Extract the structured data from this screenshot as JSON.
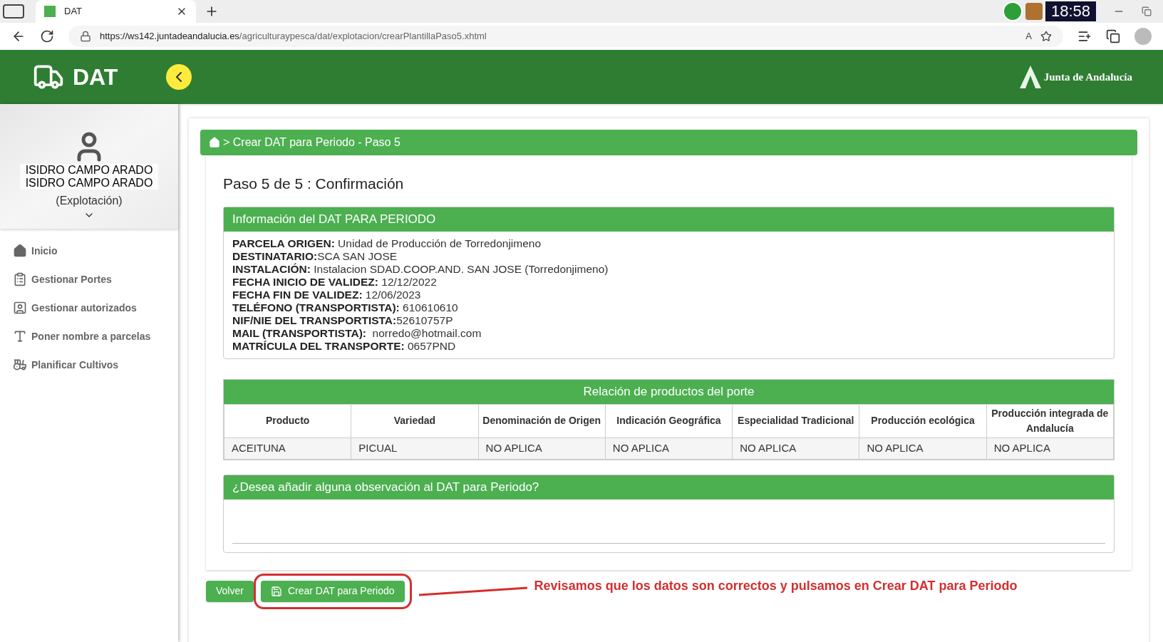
{
  "browser": {
    "tab_title": "DAT",
    "clock": "18:58",
    "url_host": "https://ws142.juntadeandalucia.es",
    "url_path": "/agriculturaypesca/dat/explotacion/crearPlantillaPaso5.xhtml",
    "reader_label": "A"
  },
  "header": {
    "app_name": "DAT",
    "brand": "Junta de Andalucía"
  },
  "user": {
    "lines": [
      "ISIDRO CAMPO ARADO",
      "ISIDRO CAMPO ARADO"
    ],
    "role": "(Explotación)"
  },
  "sidebar": {
    "items": [
      {
        "label": "Inicio",
        "kind": "home"
      },
      {
        "label": "Gestionar Portes",
        "kind": "clipboard"
      },
      {
        "label": "Gestionar autorizados",
        "kind": "badge"
      },
      {
        "label": "Poner nombre a parcelas",
        "kind": "text"
      },
      {
        "label": "Planificar Cultivos",
        "kind": "tractor"
      }
    ]
  },
  "breadcrumb": "> Crear DAT para Periodo - Paso 5",
  "step_title": "Paso 5 de 5 : Confirmación",
  "info": {
    "title": "Información del DAT PARA PERIODO",
    "fields": [
      {
        "label": "PARCELA ORIGEN:",
        "value": " Unidad de Producción de Torredonjimeno"
      },
      {
        "label": "DESTINATARIO:",
        "value": "SCA SAN JOSE"
      },
      {
        "label": "INSTALACIÓN:",
        "value": " Instalacion SDAD.COOP.AND. SAN JOSE (Torredonjimeno)"
      },
      {
        "label": "FECHA INICIO DE VALIDEZ:",
        "value": " 12/12/2022"
      },
      {
        "label": "FECHA FIN DE VALIDEZ:",
        "value": " 12/06/2023"
      },
      {
        "label": "TELÉFONO (TRANSPORTISTA):",
        "value": " 610610610"
      },
      {
        "label": "NIF/NIE DEL TRANSPORTISTA:",
        "value": "52610757P"
      },
      {
        "label": "MAIL (TRANSPORTISTA):",
        "value": "  norredo@hotmail.com"
      },
      {
        "label": "MATRÍCULA DEL TRANSPORTE:",
        "value": " 0657PND"
      }
    ]
  },
  "products": {
    "title": "Relación de productos del porte",
    "columns": [
      "Producto",
      "Variedad",
      "Denominación de Origen",
      "Indicación Geográfica",
      "Especialidad Tradicional",
      "Producción ecológica",
      "Producción integrada de Andalucía"
    ],
    "rows": [
      [
        "ACEITUNA",
        "PICUAL",
        "NO APLICA",
        "NO APLICA",
        "NO APLICA",
        "NO APLICA",
        "NO APLICA"
      ]
    ]
  },
  "observations": {
    "title": "¿Desea añadir alguna observación al DAT para Periodo?"
  },
  "buttons": [
    {
      "label": "Volver",
      "kind": "plain"
    },
    {
      "label": "Crear DAT para Periodo",
      "kind": "save"
    }
  ],
  "annotation": "Revisamos que los datos son correctos y pulsamos en Crear DAT para Periodo"
}
